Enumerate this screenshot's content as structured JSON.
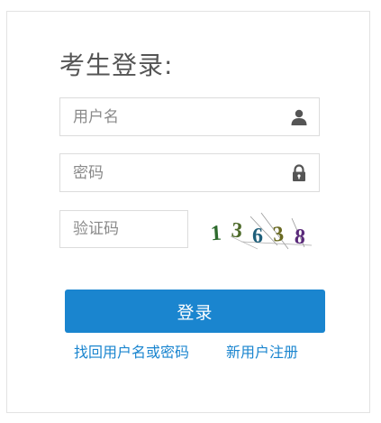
{
  "form": {
    "title": "考生登录:",
    "username_placeholder": "用户名",
    "username_value": "",
    "password_placeholder": "密码",
    "password_value": "",
    "captcha_placeholder": "验证码",
    "captcha_value": "",
    "captcha_text": [
      "1",
      "3",
      "6",
      "3",
      "8"
    ],
    "captcha_colors": [
      "#2e6b2e",
      "#4d6a2a",
      "#1f5f7a",
      "#6a6a22",
      "#5a2a7a"
    ],
    "login_label": "登录",
    "forgot_link": "找回用户名或密码",
    "register_link": "新用户注册"
  },
  "colors": {
    "accent": "#1a85cf",
    "border": "#dcdcdc",
    "title": "#555555",
    "placeholder": "#8a8a8a"
  },
  "icons": {
    "username": "user-icon",
    "password": "lock-icon"
  }
}
